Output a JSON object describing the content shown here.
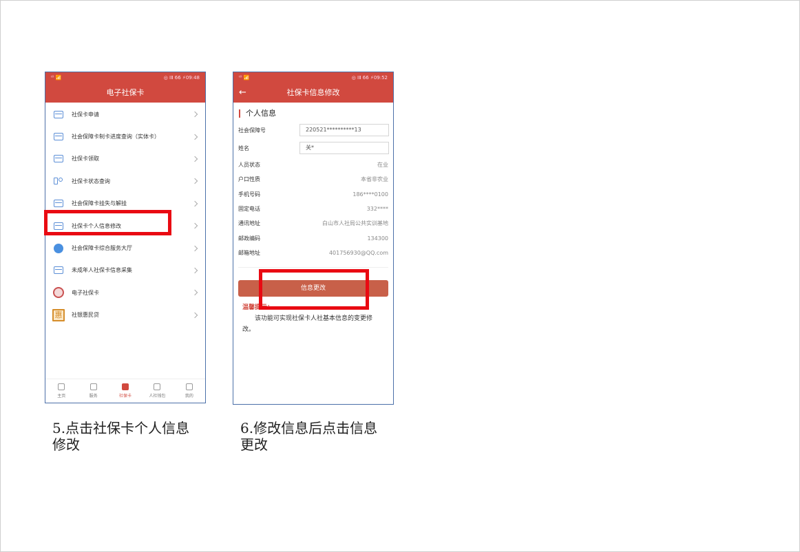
{
  "phone1": {
    "status_left": "ᵗˡˡ 📶",
    "status_right": "◎ ⅠⅡ 66 ⚡09:48",
    "title": "电子社保卡",
    "menu": [
      {
        "label": "社保卡申请",
        "icon": "card-icon"
      },
      {
        "label": "社会保障卡制卡进度查询（实体卡）",
        "icon": "card-list-icon"
      },
      {
        "label": "社保卡领取",
        "icon": "card-icon"
      },
      {
        "label": "社保卡状态查询",
        "icon": "people-icon"
      },
      {
        "label": "社会保障卡挂失与解挂",
        "icon": "card-lock-icon"
      },
      {
        "label": "社保卡个人信息修改",
        "icon": "card-icon"
      },
      {
        "label": "社会保障卡综合服务大厅",
        "icon": "hall-logo-icon"
      },
      {
        "label": "未成年人社保卡信息采集",
        "icon": "card-icon"
      },
      {
        "label": "电子社保卡",
        "icon": "seal-icon"
      },
      {
        "label": "社银惠民贷",
        "icon": "hui-icon"
      }
    ],
    "tabs": [
      {
        "label": "主页",
        "icon": "home-icon"
      },
      {
        "label": "服务",
        "icon": "grid-icon"
      },
      {
        "label": "社保卡",
        "icon": "card-tab-icon"
      },
      {
        "label": "人社钱包",
        "icon": "wallet-icon"
      },
      {
        "label": "我的",
        "icon": "user-icon"
      }
    ]
  },
  "phone2": {
    "status_left": "ᵗˡˡ 📶",
    "status_right": "◎ ⅠⅡ 66 ⚡09:52",
    "title": "社保卡信息修改",
    "back_icon": "←",
    "section_title": "个人信息",
    "inputs": [
      {
        "label": "社会保障号",
        "value": "220521**********13"
      },
      {
        "label": "姓名",
        "value": "关*"
      }
    ],
    "rows": [
      {
        "label": "人员状态",
        "value": "在业"
      },
      {
        "label": "户口性质",
        "value": "本省非农业"
      },
      {
        "label": "手机号码",
        "value": "186****0100"
      },
      {
        "label": "固定电话",
        "value": "332****"
      },
      {
        "label": "通讯地址",
        "value": "白山市人社局公共实训基地"
      },
      {
        "label": "邮政编码",
        "value": "134300"
      },
      {
        "label": "邮箱地址",
        "value": "401756930@QQ.com"
      }
    ],
    "button_label": "信息更改",
    "tips_title": "温馨提示：",
    "tips_body": "该功能可实现社保卡人社基本信息的变更修改。"
  },
  "captions": {
    "step5": "5.点击社保卡个人信息修改",
    "step6": "6.修改信息后点击信息更改"
  },
  "colors": {
    "header_red": "#d1493f",
    "highlight_red": "#e90a12",
    "button": "#c86049"
  }
}
